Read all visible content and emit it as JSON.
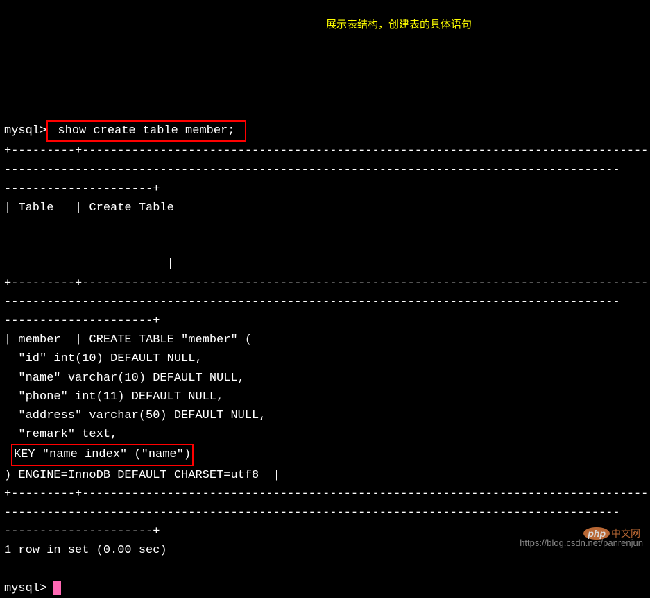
{
  "prompt1": "mysql>",
  "command": " show create table member; ",
  "annotation": "展示表结构，创建表的具体语句",
  "sep_small": "+---------+",
  "sep_long": "---------------------------------------------------------------------------------------",
  "sep_tail": "---------------------+",
  "header_row": "| Table   | Create Table",
  "blank_pipe": "                       |",
  "body_row1": "| member  | CREATE TABLE \"member\" (",
  "body_1": "  \"id\" int(10) DEFAULT NULL,",
  "body_2": "  \"name\" varchar(10) DEFAULT NULL,",
  "body_3": "  \"phone\" int(11) DEFAULT NULL,",
  "body_4": "  \"address\" varchar(50) DEFAULT NULL,",
  "body_5": "  \"remark\" text,",
  "key_line": "KEY \"name_index\" (\"name\")",
  "body_end": ") ENGINE=InnoDB DEFAULT CHARSET=utf8  |",
  "rows_msg": "1 row in set (0.00 sec)",
  "prompt2": "mysql> ",
  "watermark": "https://blog.csdn.net/panrenjun",
  "logo_text": "php",
  "logo_cn": "中文网"
}
